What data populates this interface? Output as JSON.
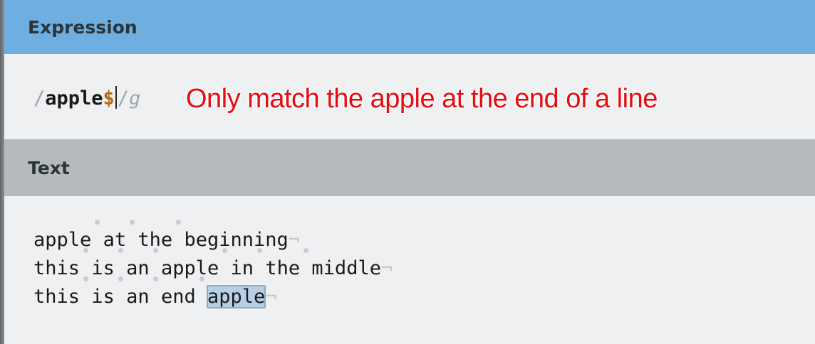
{
  "panels": {
    "expression_header": "Expression",
    "text_header": "Text"
  },
  "expression": {
    "open_delimiter": "/",
    "pattern": "apple",
    "anchor": "$",
    "close_delimiter": "/",
    "flags": "g"
  },
  "annotation": "Only match the apple at the end of a line",
  "text": {
    "lines": [
      {
        "words": [
          "apple",
          "at",
          "the",
          "beginning"
        ],
        "match": null
      },
      {
        "words": [
          "this",
          "is",
          "an",
          "apple",
          "in",
          "the",
          "middle"
        ],
        "match": null
      },
      {
        "words": [
          "this",
          "is",
          "an",
          "end",
          "apple"
        ],
        "match": 4
      }
    ],
    "eol_marker": "¬"
  },
  "colors": {
    "expression_header_bg": "#6eaee0",
    "text_header_bg": "#b5babf",
    "anchor": "#b86a12",
    "annotation": "#e30d12",
    "match_highlight": "#b6cfe5"
  }
}
